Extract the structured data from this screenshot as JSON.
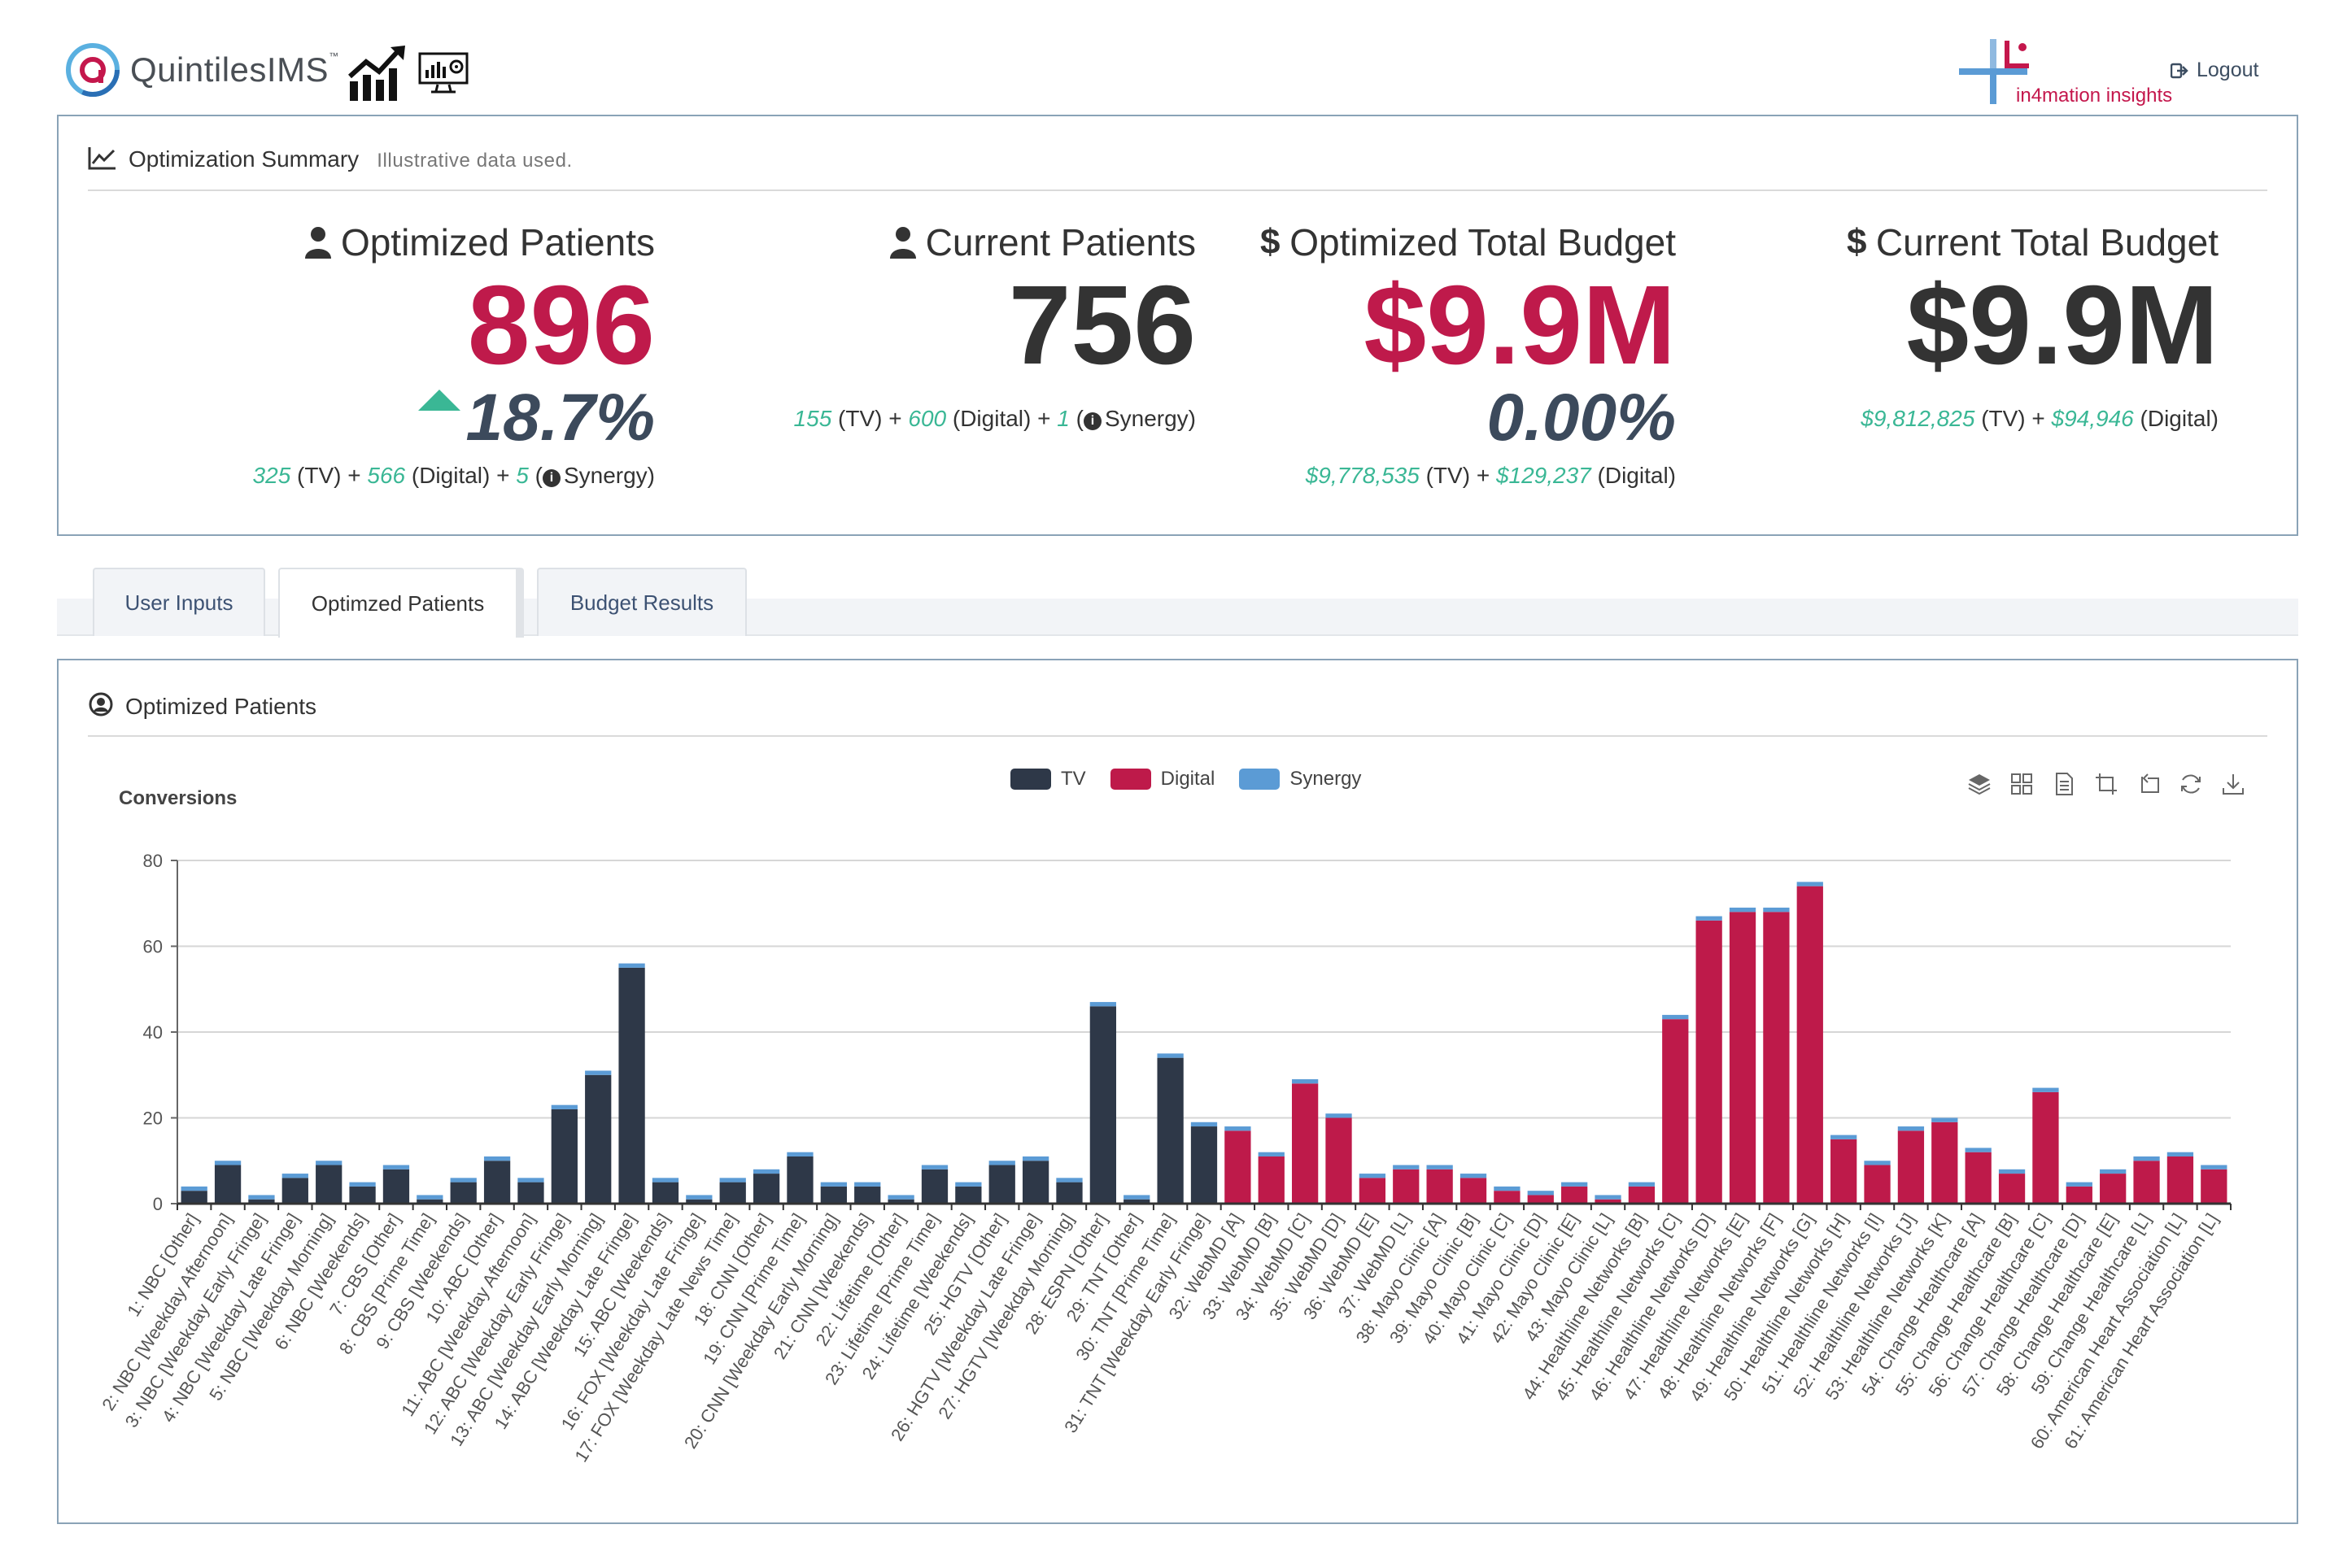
{
  "header": {
    "brand": "QuintilesIMS",
    "brand_tm": "™",
    "partner_prefix": "in",
    "partner_number": "4",
    "partner_mid": "mation ",
    "partner_suffix": "insights",
    "logout_label": "Logout",
    "icons": [
      "trend-chart-icon",
      "monitor-settings-icon",
      "logout-icon"
    ]
  },
  "summary": {
    "title": "Optimization Summary",
    "subtitle": "Illustrative data used.",
    "metrics": [
      {
        "title": "Optimized Patients",
        "icon": "user-icon",
        "value": "896",
        "pct": "18.7%",
        "pct_up": true,
        "breakdown": {
          "tv": "325",
          "tv_label": "(TV) +",
          "digital": "566",
          "digital_label": "(Digital) +",
          "synergy": "5",
          "synergy_label": "Synergy)"
        }
      },
      {
        "title": "Current Patients",
        "icon": "user-icon",
        "value": "756",
        "breakdown": {
          "tv": "155",
          "tv_label": "(TV) +",
          "digital": "600",
          "digital_label": "(Digital) +",
          "synergy": "1",
          "synergy_label": "Synergy)"
        }
      },
      {
        "title": "Optimized Total Budget",
        "icon": "dollar-icon",
        "value": "$9.9M",
        "pct": "0.00%",
        "breakdown": {
          "tv": "$9,778,535",
          "tv_label": "(TV) +",
          "digital": "$129,237",
          "digital_label": "(Digital)"
        }
      },
      {
        "title": "Current Total Budget",
        "icon": "dollar-icon",
        "value": "$9.9M",
        "breakdown": {
          "tv": "$9,812,825",
          "tv_label": "(TV) +",
          "digital": "$94,946",
          "digital_label": "(Digital)"
        }
      }
    ]
  },
  "tabs": [
    {
      "label": "User Inputs",
      "active": false
    },
    {
      "label": "Optimzed Patients",
      "active": true
    },
    {
      "label": "Budget Results",
      "active": false
    }
  ],
  "chart_panel": {
    "title": "Optimized Patients",
    "toolbox": [
      "data-view-icon",
      "grid-icon",
      "document-icon",
      "zoom-icon",
      "zoom-reset-icon",
      "restore-icon",
      "download-icon"
    ]
  },
  "colors": {
    "tv": "#2e3848",
    "digital": "#be1a4a",
    "synergy": "#5b9bd5",
    "accent_red": "#bf1a4b",
    "accent_green": "#3ab795"
  },
  "chart_data": {
    "type": "bar",
    "stacked": true,
    "ylabel": "Conversions",
    "ylim": [
      0,
      80
    ],
    "yticks": [
      0,
      20,
      40,
      60,
      80
    ],
    "grid": true,
    "legend_position": "top-center",
    "categories": [
      "1: NBC [Other]",
      "2: NBC [Weekday Afternoon]",
      "3: NBC [Weekday Early Fringe]",
      "4: NBC [Weekday Late Fringe]",
      "5: NBC [Weekday Morning]",
      "6: NBC [Weekends]",
      "7: CBS [Other]",
      "8: CBS [Prime Time]",
      "9: CBS [Weekends]",
      "10: ABC [Other]",
      "11: ABC [Weekday Afternoon]",
      "12: ABC [Weekday Early Fringe]",
      "13: ABC [Weekday Early Morning]",
      "14: ABC [Weekday Late Fringe]",
      "15: ABC [Weekends]",
      "16: FOX [Weekday Late Fringe]",
      "17: FOX [Weekday Late News Time]",
      "18: CNN [Other]",
      "19: CNN [Prime Time]",
      "20: CNN [Weekday Early Morning]",
      "21: CNN [Weekends]",
      "22: Lifetime [Other]",
      "23: Lifetime [Prime Time]",
      "24: Lifetime [Weekends]",
      "25: HGTV [Other]",
      "26: HGTV [Weekday Late Fringe]",
      "27: HGTV [Weekday Morning]",
      "28: ESPN [Other]",
      "29: TNT [Other]",
      "30: TNT [Prime Time]",
      "31: TNT [Weekday Early Fringe]",
      "32: WebMD [A]",
      "33: WebMD [B]",
      "34: WebMD [C]",
      "35: WebMD [D]",
      "36: WebMD [E]",
      "37: WebMD [L]",
      "38: Mayo Clinic [A]",
      "39: Mayo Clinic [B]",
      "40: Mayo Clinic [C]",
      "41: Mayo Clinic [D]",
      "42: Mayo Clinic [E]",
      "43: Mayo Clinic [L]",
      "44: Healthline Networks [B]",
      "45: Healthline Networks [C]",
      "46: Healthline Networks [D]",
      "47: Healthline Networks [E]",
      "48: Healthline Networks [F]",
      "49: Healthline Networks [G]",
      "50: Healthline Networks [H]",
      "51: Healthline Networks [I]",
      "52: Healthline Networks [J]",
      "53: Healthline Networks [K]",
      "54: Change Healthcare [A]",
      "55: Change Healthcare [B]",
      "56: Change Healthcare [C]",
      "57: Change Healthcare [D]",
      "58: Change Healthcare [E]",
      "59: Change Healthcare [L]",
      "60: American Heart Association [L]",
      "61: American Heart Association [L]"
    ],
    "series": [
      {
        "name": "TV",
        "values": [
          3,
          9,
          1,
          6,
          9,
          4,
          8,
          1,
          5,
          10,
          5,
          22,
          30,
          55,
          5,
          1,
          5,
          7,
          11,
          4,
          4,
          1,
          8,
          4,
          9,
          10,
          5,
          46,
          1,
          34,
          18,
          0,
          0,
          0,
          0,
          0,
          0,
          0,
          0,
          0,
          0,
          0,
          0,
          0,
          0,
          0,
          0,
          0,
          0,
          0,
          0,
          0,
          0,
          0,
          0,
          0,
          0,
          0,
          0,
          0,
          0
        ]
      },
      {
        "name": "Digital",
        "values": [
          0,
          0,
          0,
          0,
          0,
          0,
          0,
          0,
          0,
          0,
          0,
          0,
          0,
          0,
          0,
          0,
          0,
          0,
          0,
          0,
          0,
          0,
          0,
          0,
          0,
          0,
          0,
          0,
          0,
          0,
          0,
          17,
          11,
          28,
          20,
          6,
          8,
          8,
          6,
          3,
          2,
          4,
          1,
          4,
          43,
          66,
          68,
          68,
          74,
          15,
          9,
          17,
          19,
          12,
          7,
          26,
          4,
          7,
          10,
          11,
          8
        ]
      },
      {
        "name": "Synergy",
        "values": [
          1,
          1,
          1,
          1,
          1,
          1,
          1,
          1,
          1,
          1,
          1,
          1,
          1,
          1,
          1,
          1,
          1,
          1,
          1,
          1,
          1,
          1,
          1,
          1,
          1,
          1,
          1,
          1,
          1,
          1,
          1,
          1,
          1,
          1,
          1,
          1,
          1,
          1,
          1,
          1,
          1,
          1,
          1,
          1,
          1,
          1,
          1,
          1,
          1,
          1,
          1,
          1,
          1,
          1,
          1,
          1,
          1,
          1,
          1,
          1,
          1
        ]
      }
    ]
  }
}
